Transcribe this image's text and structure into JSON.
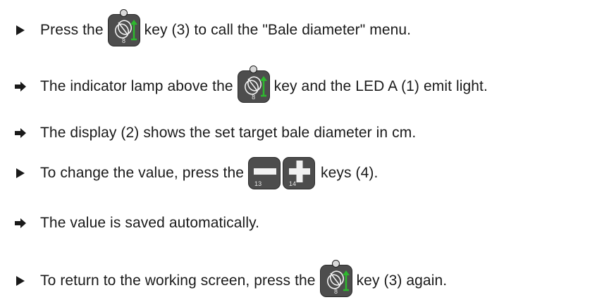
{
  "steps": [
    {
      "type": "action",
      "before": "Press the",
      "key": "diameter",
      "after": "key (3) to call the \"Bale diameter\" menu."
    },
    {
      "type": "result",
      "before": "The indicator lamp above the",
      "key": "diameter",
      "after": "key and the LED A (1) emit light."
    },
    {
      "type": "result",
      "before": "The display (2) shows the set target bale diameter in cm.",
      "key": null,
      "after": ""
    },
    {
      "type": "action",
      "before": "To change the value, press the",
      "key": "minus-plus",
      "after": "keys (4)."
    },
    {
      "type": "result",
      "before": "The value is saved automatically.",
      "key": null,
      "after": ""
    },
    {
      "type": "action",
      "before": "To return to the working screen, press the",
      "key": "diameter",
      "after": "key (3) again."
    }
  ],
  "keys": {
    "diameter_number": "8",
    "minus_number": "13",
    "plus_number": "14"
  },
  "colors": {
    "key_body": "#4d4d4d",
    "accent_green": "#2eb82e"
  },
  "icons": {
    "action_bullet": "triangle-right",
    "result_bullet": "arrow-right"
  }
}
